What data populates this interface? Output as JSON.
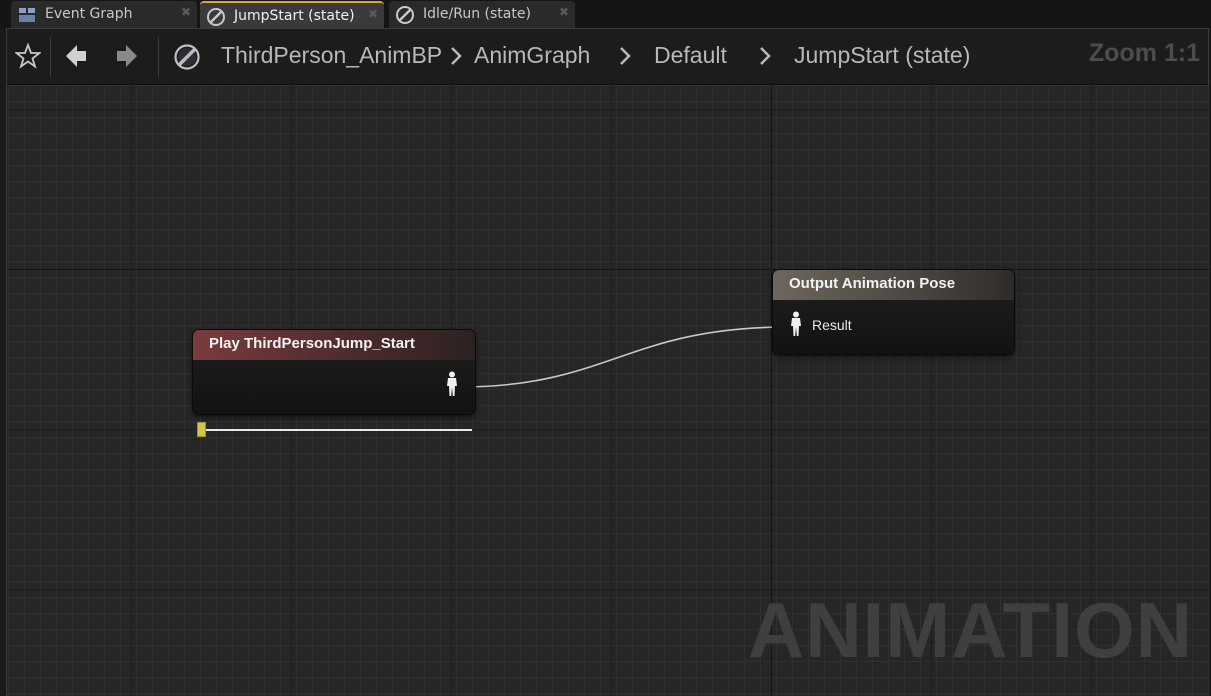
{
  "tabs": [
    {
      "label": "Event Graph",
      "icon": "event-graph-icon",
      "active": false
    },
    {
      "label": "JumpStart (state)",
      "icon": "state-icon",
      "active": true
    },
    {
      "label": "Idle/Run (state)",
      "icon": "state-icon",
      "active": false
    }
  ],
  "toolbar": {
    "breadcrumb": [
      "ThirdPerson_AnimBP",
      "AnimGraph",
      "Default",
      "JumpStart (state)"
    ],
    "zoom": "Zoom 1:1"
  },
  "graph": {
    "watermark": "ANIMATION",
    "nodes": {
      "play": {
        "title": "Play ThirdPersonJump_Start",
        "playback_position": 0.0
      },
      "output": {
        "title": "Output Animation Pose",
        "pin_label": "Result"
      }
    }
  },
  "colors": {
    "play_header": "#7a3b3d",
    "output_header": "#6e665c",
    "active_tab_accent": "#d5a93e",
    "wire": "#c9c9c9"
  }
}
